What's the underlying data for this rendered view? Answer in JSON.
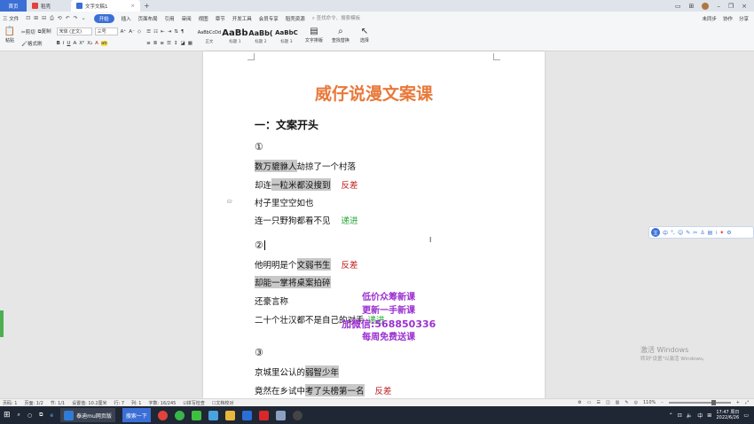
{
  "tabs": {
    "home": "首页",
    "docer": "稻壳",
    "active": "文字文稿1",
    "plus": "+"
  },
  "menu": {
    "file": "三 文件",
    "quick_access": "⊡ ⊞ ⊟ ⎙ ⟲ ↶ ↷ ⌄",
    "items": [
      "开始",
      "插入",
      "页面布局",
      "引用",
      "审阅",
      "视图",
      "章节",
      "开发工具",
      "会员专享",
      "稻壳资源"
    ],
    "search": "查找命令、搜索模板",
    "right": [
      "未同步",
      "协作",
      "分享"
    ]
  },
  "ribbon": {
    "paste": "粘贴",
    "cut": "剪切",
    "copy": "复制",
    "format_painter": "格式刷",
    "font_name": "宋体 (正文)",
    "font_size": "三号",
    "styles": [
      {
        "preview": "AaBbCcDd",
        "name": "正文"
      },
      {
        "preview": "AaBb",
        "name": "标题 1"
      },
      {
        "preview": "AaBb(",
        "name": "标题 2"
      },
      {
        "preview": "AaBbC",
        "name": "标题 3"
      }
    ],
    "text_layout": "文字排版",
    "find_replace": "查找替换",
    "select": "选择"
  },
  "document": {
    "title": "威仔说漫文案课",
    "section1": "一：文案开头",
    "marker1": "①",
    "l1_hl": "数万貔貅人",
    "l1_rest": "劫掠了一个村落",
    "l2_a": "却连",
    "l2_hl": "一粒米都没搜到",
    "l2_note": "反差",
    "l3": "村子里空空如也",
    "l4": "连一只野狗都看不见",
    "l4_note": "递进",
    "marker2": "②",
    "l5_a": "他明明是个",
    "l5_hl": "文弱书生",
    "l5_note": "反差",
    "l6_hl": "却能一掌将桌案拍碎",
    "l7": "还豪言称",
    "l8": "二十个壮汉都不是自己的对手",
    "l8_note": "递进",
    "marker3": "③",
    "l9_a": "京城里公认的",
    "l9_hl": "弱智少年",
    "l10_a": "竟然在乡试中",
    "l10_hl": "考了头榜第一名",
    "l10_note": "反差"
  },
  "watermark": {
    "line1": "低价众筹新课",
    "line2": "更新一手新课",
    "line3": "加微信:568850336",
    "line4": "每周免费送课"
  },
  "activation": {
    "title": "激活 Windows",
    "subtitle": "转到\"设置\"以激活 Windows。"
  },
  "status": {
    "page": "页码: 1",
    "pages": "页面: 1/2",
    "section": "节: 1/1",
    "setting": "设置值: 10.2厘米",
    "row": "行: 7",
    "col": "列: 1",
    "words": "字数: 16/245",
    "spell": "拼写检查",
    "proof": "文档校对",
    "zoom": "110%"
  },
  "taskbar": {
    "browser": "泰迪mu网页版",
    "search_btn": "搜索一下",
    "time": "17:47 周日",
    "date": "2022/6/26",
    "lang": "中"
  }
}
